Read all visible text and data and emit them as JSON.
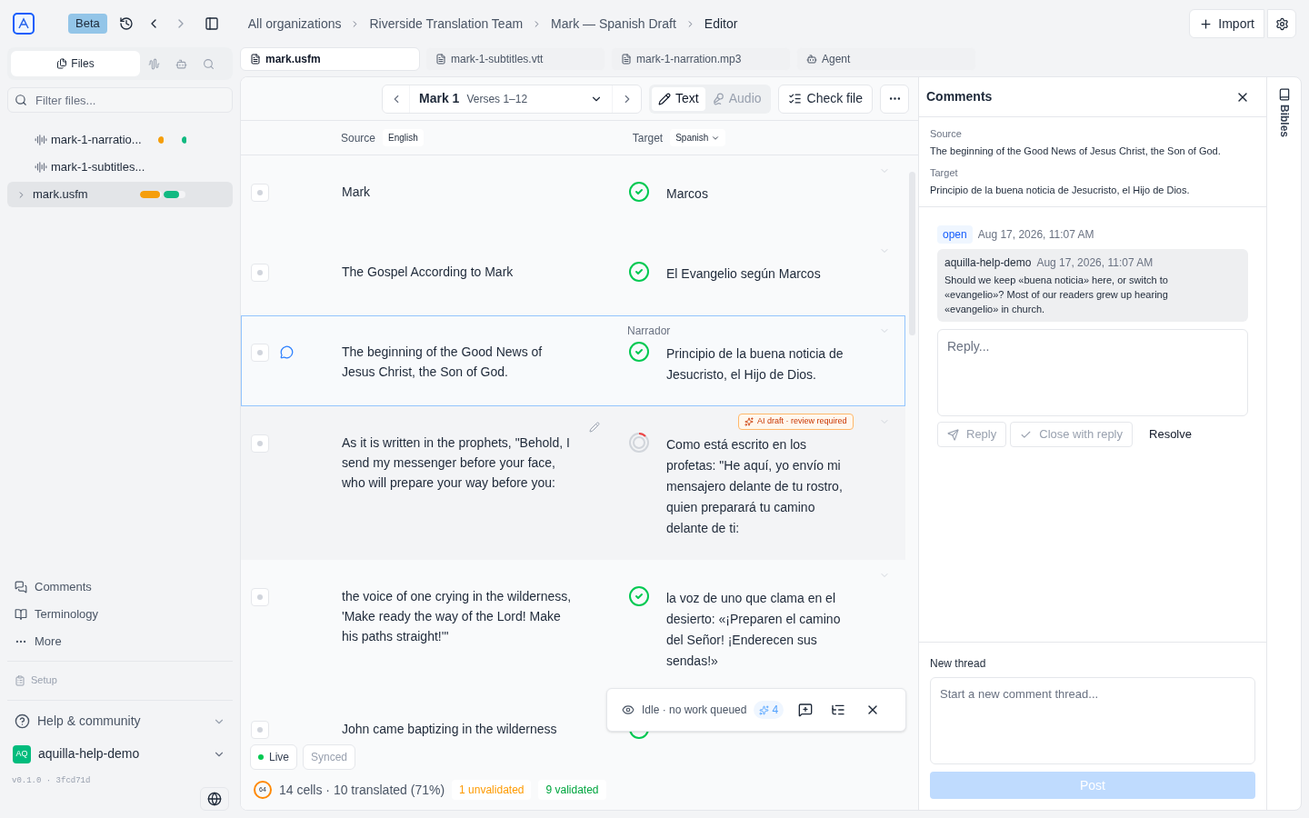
{
  "topbar": {
    "badge": "Beta",
    "breadcrumbs": [
      "All organizations",
      "Riverside Translation Team",
      "Mark — Spanish Draft",
      "Editor"
    ],
    "import_label": "Import"
  },
  "sidebar": {
    "tabs": [
      {
        "label": "Files",
        "selected": true
      },
      {
        "selected": false
      },
      {
        "selected": false
      },
      {
        "selected": false
      }
    ],
    "filter": {
      "placeholder": "Filter files..."
    },
    "files": [
      {
        "name": "mark-1-narratio...",
        "kind": "audio",
        "selected": false,
        "bars": [
          {
            "color": "#f59e0b",
            "level": 0.25
          },
          {
            "color": "#10b981",
            "level": 0.2
          }
        ]
      },
      {
        "name": "mark-1-subtitles...",
        "kind": "audio",
        "selected": false
      },
      {
        "name": "mark.usfm",
        "kind": "folder",
        "selected": true,
        "bars": [
          {
            "color": "#f59e0b",
            "level": 0.9
          },
          {
            "color": "#10b981",
            "level": 0.7
          }
        ]
      }
    ],
    "links": [
      "Comments",
      "Terminology",
      "More"
    ],
    "setup": "Setup",
    "help": "Help & community",
    "user": {
      "initials": "AQ",
      "name": "aquilla-help-demo"
    },
    "version": "v0.1.0 · 3fcd71d"
  },
  "editor_tabs": [
    {
      "label": "mark.usfm",
      "kind": "file",
      "selected": true
    },
    {
      "label": "mark-1-subtitles.vtt",
      "kind": "file",
      "selected": false
    },
    {
      "label": "mark-1-narration.mp3",
      "kind": "file",
      "selected": false
    },
    {
      "label": "Agent",
      "kind": "agent",
      "selected": false
    }
  ],
  "toolbar": {
    "chapter": "Mark 1",
    "verses": "Verses 1–12",
    "modes": [
      {
        "label": "Text",
        "selected": true
      },
      {
        "label": "Audio",
        "selected": false
      }
    ],
    "check_label": "Check file"
  },
  "columns": {
    "source_label": "Source",
    "source_lang": "English",
    "target_label": "Target",
    "target_lang": "Spanish"
  },
  "cells": [
    {
      "source": "Mark",
      "target": "Marcos",
      "kind": "validated",
      "selected": false,
      "highlighted": false,
      "has_comment": false
    },
    {
      "source": "The Gospel According to Mark",
      "target": "El Evangelio según Marcos",
      "kind": "validated",
      "selected": false,
      "highlighted": false,
      "has_comment": false
    },
    {
      "source": "The beginning of the Good News of Jesus Christ, the Son of God.",
      "target": "Principio de la buena noticia de Jesucristo, el Hijo de Dios.",
      "label": "Narrador",
      "kind": "validated",
      "selected": true,
      "highlighted": false,
      "has_comment": true
    },
    {
      "source": "As it is written in the prophets, \"Behold, I send my messenger before your face, who will prepare your way before you:",
      "target": "Como está escrito en los profetas: \"He aquí, yo envío mi mensajero delante de tu rostro, quien preparará tu camino delante de ti:",
      "badge": "AI draft · review required",
      "kind": "draft",
      "selected": false,
      "highlighted": true,
      "has_comment": false
    },
    {
      "source": "the voice of one crying in the wilderness, 'Make ready the way of the Lord! Make his paths straight!'\"",
      "target": "la voz de uno que clama en el desierto: «¡Preparen el camino del Señor! ¡Enderecen sus sendas!»",
      "kind": "validated",
      "selected": false,
      "highlighted": false,
      "has_comment": false
    },
    {
      "source": "John came baptizing in the wilderness",
      "kind": "validated",
      "selected": false,
      "highlighted": false,
      "has_comment": false
    }
  ],
  "agent_bar": {
    "status": "Idle · no work queued",
    "count": "4"
  },
  "sync": [
    {
      "label": "Live",
      "kind": "live"
    },
    {
      "label": "Synced",
      "kind": "plain"
    }
  ],
  "stats": {
    "ring": "64",
    "summary": "14 cells · 10 translated (71%)",
    "unvalidated": "1 unvalidated",
    "validated": "9 validated"
  },
  "comments": {
    "title": "Comments",
    "source_label": "Source",
    "source": "The beginning of the Good News of Jesus Christ, the Son of God.",
    "target_label": "Target",
    "target": "Principio de la buena noticia de Jesucristo, el Hijo de Dios.",
    "thread": {
      "state": "open",
      "date": "Aug 17, 2026, 11:07 AM",
      "author": "aquilla-help-demo",
      "message_date": "Aug 17, 2026, 11:07 AM",
      "message": "Should we keep «buena noticia» here, or switch to «evangelio»? Most of our readers grew up hearing «evangelio» in church."
    },
    "reply": {
      "placeholder": "Reply..."
    },
    "actions": [
      {
        "label": "Reply",
        "kind": "send"
      },
      {
        "label": "Close with reply",
        "kind": "check"
      },
      {
        "label": "Resolve",
        "kind": "plain"
      }
    ],
    "new_thread_label": "New thread",
    "new_thread": {
      "placeholder": "Start a new comment thread..."
    },
    "post_label": "Post"
  },
  "rail": {
    "label": "Bibles"
  }
}
